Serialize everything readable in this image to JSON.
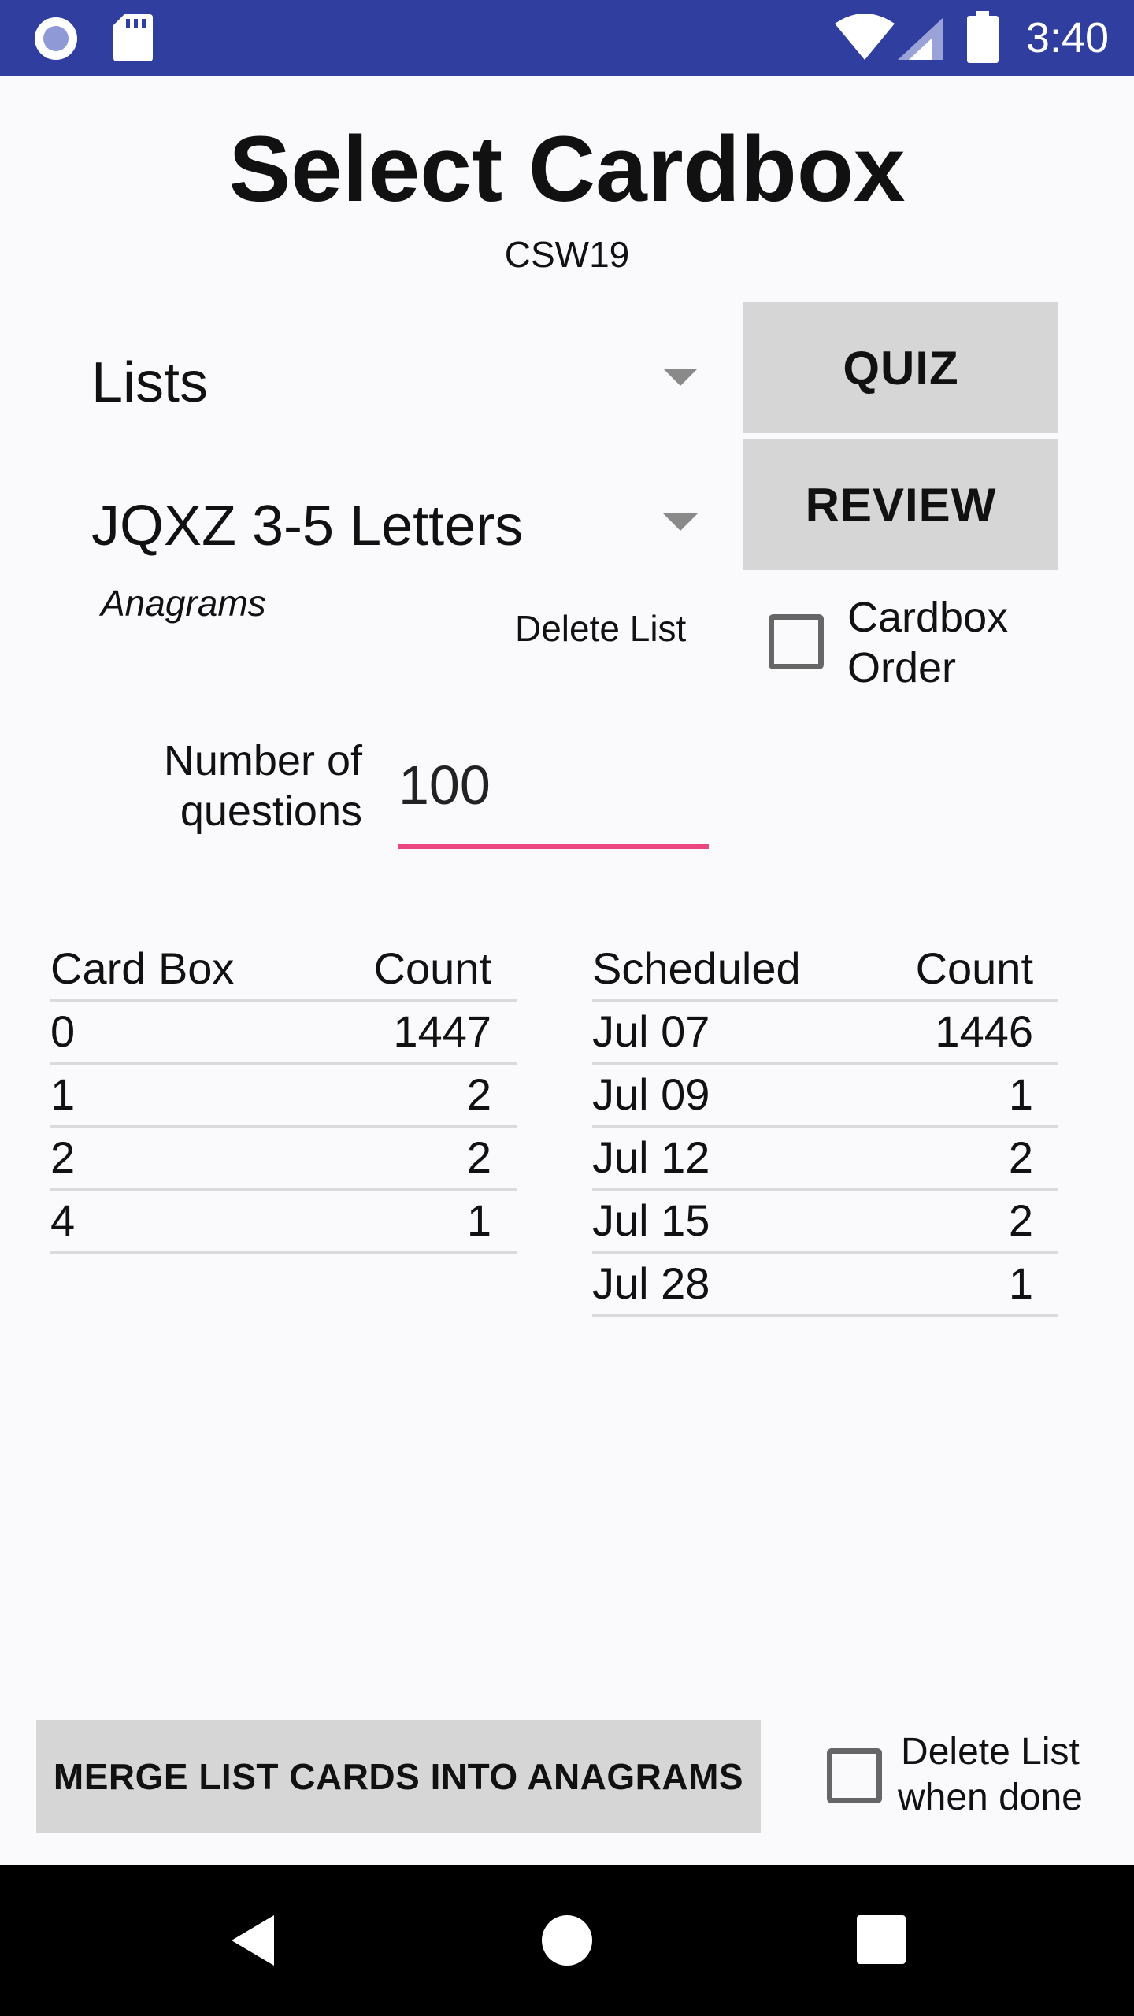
{
  "status_bar": {
    "time": "3:40",
    "icons": [
      "record-icon",
      "sd-card-icon",
      "wifi-icon",
      "signal-icon",
      "battery-icon"
    ]
  },
  "header": {
    "title": "Select Cardbox",
    "subtitle": "CSW19"
  },
  "controls": {
    "list_type_spinner": "Lists",
    "list_name_spinner": "JQXZ 3-5 Letters",
    "list_mode": "Anagrams",
    "delete_list_label": "Delete List",
    "quiz_label": "QUIZ",
    "review_label": "REVIEW",
    "cardbox_order_line1": "Cardbox",
    "cardbox_order_line2": "Order",
    "cardbox_order_checked": false,
    "num_questions_line1": "Number of",
    "num_questions_line2": "questions",
    "num_questions_value": "100"
  },
  "cardbox_table": {
    "headers": [
      "Card Box",
      "Count"
    ],
    "rows": [
      [
        "0",
        "1447"
      ],
      [
        "1",
        "2"
      ],
      [
        "2",
        "2"
      ],
      [
        "4",
        "1"
      ]
    ]
  },
  "scheduled_table": {
    "headers": [
      "Scheduled",
      "Count"
    ],
    "rows": [
      [
        "Jul 07",
        "1446"
      ],
      [
        "Jul 09",
        "1"
      ],
      [
        "Jul 12",
        "2"
      ],
      [
        "Jul 15",
        "2"
      ],
      [
        "Jul 28",
        "1"
      ]
    ]
  },
  "footer": {
    "merge_label": "MERGE LIST CARDS INTO ANAGRAMS",
    "delete_when_done_line1": "Delete List",
    "delete_when_done_line2": "when done",
    "delete_when_done_checked": false
  },
  "colors": {
    "status_bar": "#303f9f",
    "accent_underline": "#ec4680",
    "button_bg": "#d6d6d6",
    "background": "#faf9fc"
  }
}
